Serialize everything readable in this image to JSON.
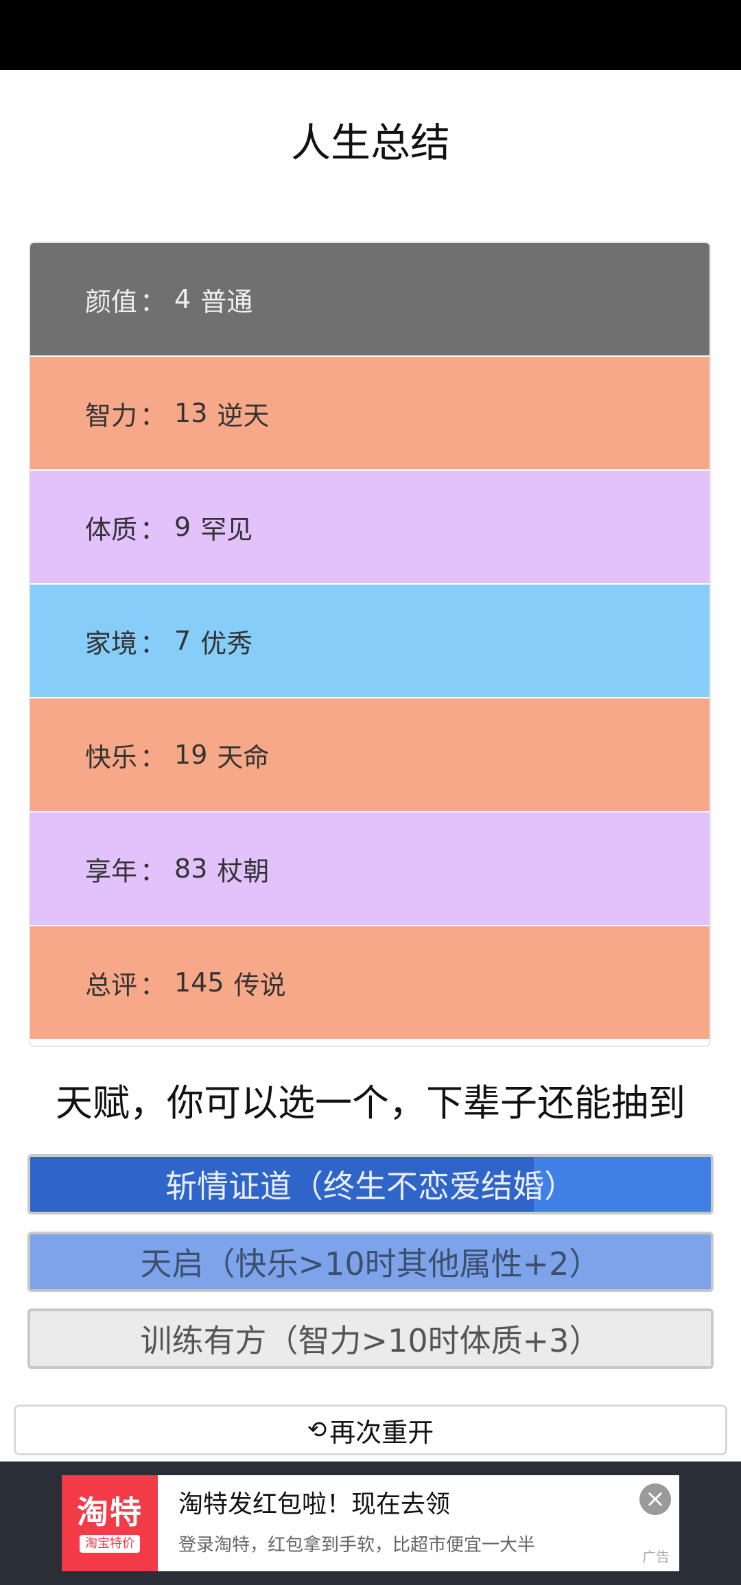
{
  "title": "人生总结",
  "stats": [
    {
      "label": "颜值",
      "value": "4",
      "grade": "普通",
      "color": "#707070",
      "text_color": "#f0f0f0"
    },
    {
      "label": "智力",
      "value": "13",
      "grade": "逆天",
      "color": "#f6a888",
      "text_color": "#333333"
    },
    {
      "label": "体质",
      "value": "9",
      "grade": "罕见",
      "color": "#e3c1fb",
      "text_color": "#333333"
    },
    {
      "label": "家境",
      "value": "7",
      "grade": "优秀",
      "color": "#87cdfa",
      "text_color": "#333333"
    },
    {
      "label": "快乐",
      "value": "19",
      "grade": "天命",
      "color": "#f6a888",
      "text_color": "#333333"
    },
    {
      "label": "享年",
      "value": "83",
      "grade": "杖朝",
      "color": "#e3c1fb",
      "text_color": "#333333"
    },
    {
      "label": "总评",
      "value": "145",
      "grade": "传说",
      "color": "#f6a888",
      "text_color": "#333333"
    }
  ],
  "stat_separator": "：",
  "talent_heading": "天赋，你可以选一个，下辈子还能抽到",
  "talents": [
    {
      "label": "斩情证道（终生不恋爱结婚）",
      "progress": 0.74
    },
    {
      "label": "天启（快乐>10时其他属性+2）"
    },
    {
      "label": "训练有方（智力>10时体质+3）"
    }
  ],
  "restart": {
    "icon": "refresh-icon",
    "label": "再次重开"
  },
  "ad": {
    "logo_big": "淘特",
    "logo_small": "淘宝特价",
    "title": "淘特发红包啦！现在去领",
    "desc": "登录淘特，红包拿到手软，比超市便宜一大半",
    "close": "×",
    "label": "广告"
  }
}
